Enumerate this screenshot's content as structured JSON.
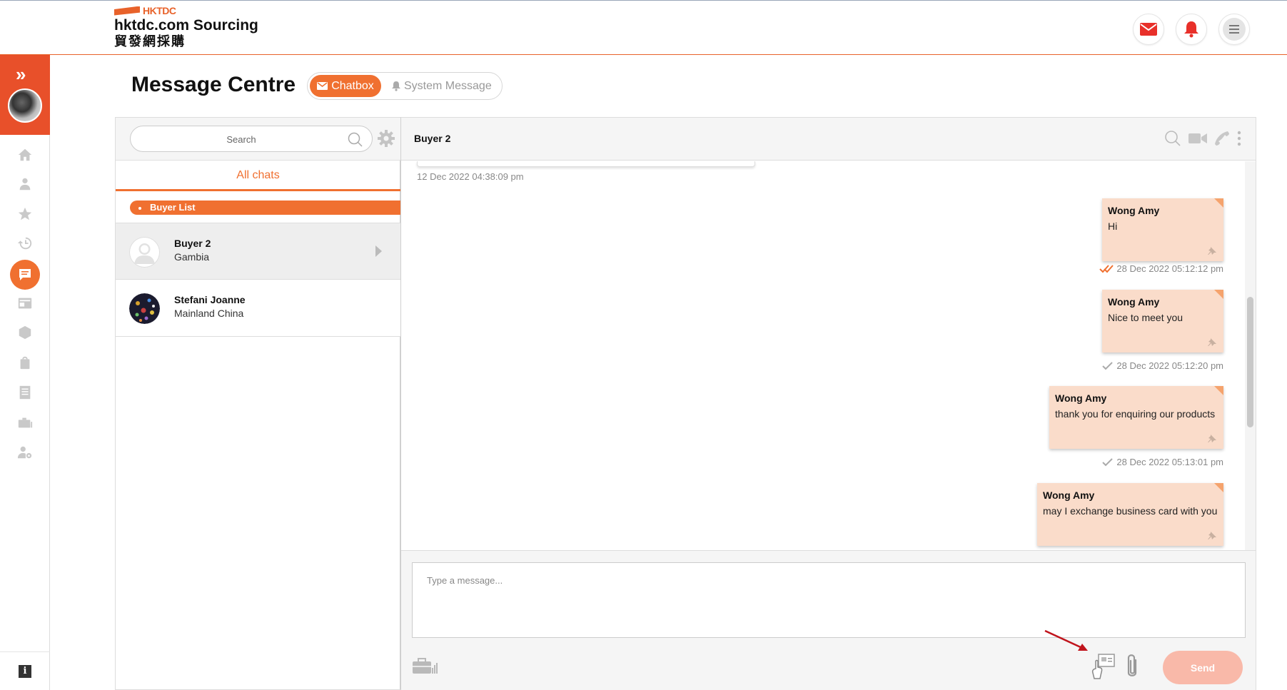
{
  "header": {
    "logo_brand": "HKTDC",
    "logo_title": "hktdc.com Sourcing",
    "logo_subtitle": "貿發網採購"
  },
  "rail": {
    "items": [
      "home-icon",
      "user-icon",
      "star-icon",
      "history-icon",
      "message-icon",
      "news-icon",
      "product-icon",
      "bag-icon",
      "list-icon",
      "briefcase-icon",
      "settings-icon"
    ],
    "active": "message-icon"
  },
  "page": {
    "title": "Message Centre",
    "tabs": [
      {
        "label": "Chatbox",
        "active": true
      },
      {
        "label": "System Message",
        "active": false
      }
    ]
  },
  "chat_list": {
    "search_placeholder": "Search",
    "filter_label": "All chats",
    "group_label": "Buyer List",
    "contacts": [
      {
        "name": "Buyer 2",
        "country": "Gambia",
        "selected": true
      },
      {
        "name": "Stefani Joanne",
        "country": "Mainland China",
        "selected": false
      }
    ]
  },
  "conversation": {
    "title": "Buyer 2",
    "previous_timestamp": "12 Dec 2022 04:38:09 pm",
    "messages": [
      {
        "sender": "Wong Amy",
        "text": "Hi",
        "time": "28 Dec 2022 05:12:12 pm",
        "status": "read"
      },
      {
        "sender": "Wong Amy",
        "text": "Nice to meet you",
        "time": "28 Dec 2022 05:12:20 pm",
        "status": "sent"
      },
      {
        "sender": "Wong Amy",
        "text": "thank you for enquiring our products",
        "time": "28 Dec 2022 05:13:01 pm",
        "status": "sent"
      },
      {
        "sender": "Wong Amy",
        "text": "may I exchange business card with you",
        "time": "",
        "status": ""
      }
    ],
    "composer_placeholder": "Type a message...",
    "send_label": "Send"
  },
  "colors": {
    "accent": "#f07030",
    "bubble": "#fadcca",
    "send_disabled": "#f9b9a9",
    "read_tick": "#f07030",
    "sent_tick": "#aaaaaa"
  }
}
